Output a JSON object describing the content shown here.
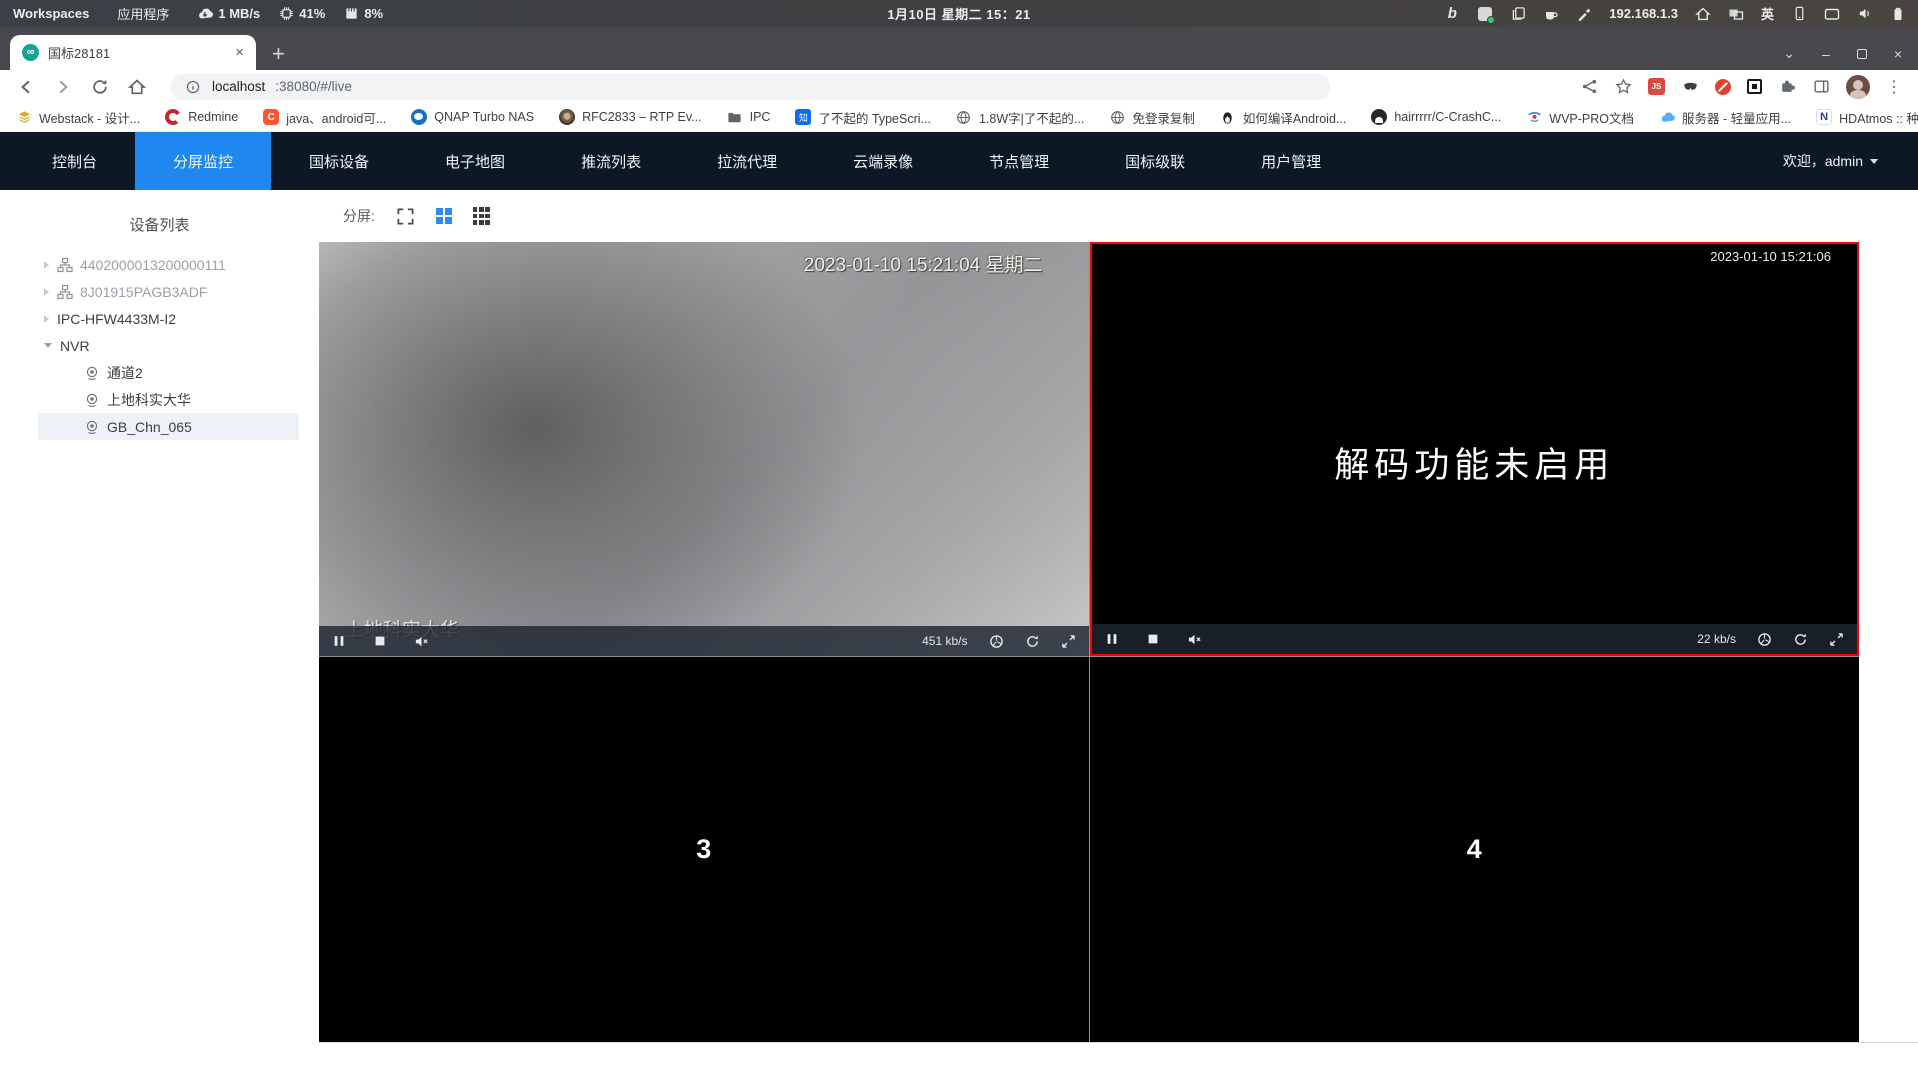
{
  "system_bar": {
    "workspaces_label": "Workspaces",
    "applications_label": "应用程序",
    "net_speed": "1 MB/s",
    "cpu_usage": "41%",
    "memory_usage": "8%",
    "datetime": "1月10日 星期二 15：21",
    "ip_address": "192.168.1.3",
    "input_language": "英",
    "right_icons": [
      "bing-icon",
      "screenshot-app-icon",
      "clipboard-icon",
      "coffee-icon",
      "color-picker-icon",
      "home-icon",
      "workspace-switcher-icon",
      "language-indicator",
      "phone-link-icon",
      "display-icon",
      "volume-icon",
      "battery-icon"
    ]
  },
  "browser": {
    "tab_title": "国标28181",
    "url_host": "localhost",
    "url_path": ":38080/#/live",
    "glyphs": {
      "new_tab": "+",
      "tab_close": "×",
      "tabs_caret": "⌄",
      "minimize": "–",
      "close_window": "×",
      "menu_dots": "⋮",
      "bookmarks_overflow": "»",
      "js_badge": "JS",
      "infinity": "∞"
    },
    "bookmarks": [
      {
        "label": "Webstack - 设计...",
        "icon": "layers-icon"
      },
      {
        "label": "Redmine",
        "icon": "redmine-icon"
      },
      {
        "label": "java、android可...",
        "icon": "csdn-icon",
        "glyph": "C"
      },
      {
        "label": "QNAP Turbo NAS",
        "icon": "qnap-icon"
      },
      {
        "label": "RFC2833 – RTP Ev...",
        "icon": "disc-icon"
      },
      {
        "label": "IPC",
        "icon": "folder-icon"
      },
      {
        "label": "了不起的 TypeScri...",
        "icon": "zhihu-icon",
        "glyph": "知"
      },
      {
        "label": "1.8W字|了不起的...",
        "icon": "globe-icon"
      },
      {
        "label": "免登录复制",
        "icon": "globe-icon"
      },
      {
        "label": "如何编译Android...",
        "icon": "tux-icon"
      },
      {
        "label": "hairrrrr/C-CrashC...",
        "icon": "github-icon"
      },
      {
        "label": "WVP-PRO文档",
        "icon": "wvp-icon"
      },
      {
        "label": "服务器 - 轻量应用...",
        "icon": "cloud-icon"
      },
      {
        "label": "HDAtmos :: 种子 *...",
        "icon": "hdatmos-icon",
        "glyph": "N"
      }
    ]
  },
  "nav": {
    "items": [
      "控制台",
      "分屏监控",
      "国标设备",
      "电子地图",
      "推流列表",
      "拉流代理",
      "云端录像",
      "节点管理",
      "国标级联",
      "用户管理"
    ],
    "active_index": 1,
    "welcome": "欢迎，admin"
  },
  "device_panel": {
    "title": "设备列表",
    "tree": [
      {
        "label": "4402000013200000111",
        "type": "platform",
        "muted": true
      },
      {
        "label": "8J01915PAGB3ADF",
        "type": "platform",
        "muted": true
      },
      {
        "label": "IPC-HFW4433M-I2",
        "type": "device"
      },
      {
        "label": "NVR",
        "type": "device",
        "expanded": true,
        "children": [
          {
            "label": "通道2"
          },
          {
            "label": "上地科实大华"
          },
          {
            "label": "GB_Chn_065",
            "selected": true
          }
        ]
      }
    ]
  },
  "screen_toolbar": {
    "label": "分屏:"
  },
  "videos": {
    "cell1": {
      "osd_time": "2023-01-10 15:21:04 星期二",
      "osd_label": "上地科实大华",
      "bitrate": "451 kb/s",
      "state": "playing"
    },
    "cell2": {
      "message": "解码功能未启用",
      "osd_time": "2023-01-10 15:21:06",
      "bitrate": "22 kb/s",
      "state": "decode-disabled",
      "selected": true
    },
    "cell3": {
      "placeholder": "3"
    },
    "cell4": {
      "placeholder": "4"
    }
  },
  "colors": {
    "accent_blue": "#1e87f0",
    "nav_bg": "#0c1823",
    "selected_cell_border": "#fb0007",
    "favicon_teal": "#17a294"
  }
}
